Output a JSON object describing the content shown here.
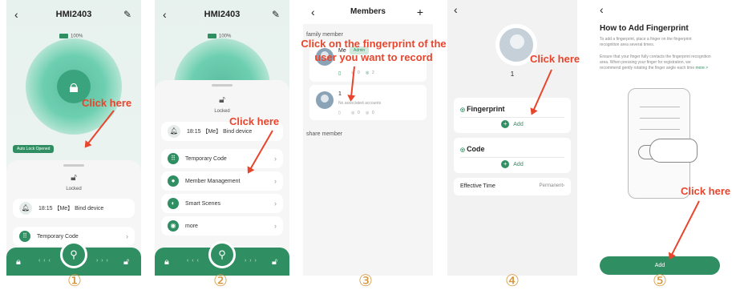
{
  "panel1": {
    "title": "HMI2403",
    "battery": "100%",
    "badge": "Auto Lock Opened",
    "locked": "Locked",
    "log": "18:15 【Me】 Bind device",
    "menu1": "Temporary Code",
    "callout": "Click here",
    "step": "①"
  },
  "panel2": {
    "title": "HMI2403",
    "battery": "100%",
    "locked": "Locked",
    "log": "18:15 【Me】 Bind device",
    "callout": "Click here",
    "menu": [
      "Temporary Code",
      "Member Management",
      "Smart Scenes",
      "more"
    ],
    "step": "②"
  },
  "panel3": {
    "title": "Members",
    "family": "family member",
    "callout": "Click on the fingerprint of the user you want to record",
    "me": "Me",
    "admin": "Admin",
    "m2": "1",
    "m2sub": "No associated accounts",
    "share": "share member",
    "counts1": [
      "0",
      "2"
    ],
    "counts2": [
      "0",
      "0"
    ],
    "step": "③"
  },
  "panel4": {
    "name": "1",
    "callout": "Click here",
    "fingerprint": "Fingerprint",
    "code": "Code",
    "add": "Add",
    "eff": "Effective Time",
    "perm": "Permanent",
    "step": "④"
  },
  "panel5": {
    "title": "How to Add Fingerprint",
    "p1": "To add a fingerprint, place a finger on the fingerprint recognition area several times.",
    "p2": "Ensure that your finger fully contacts the fingerprint recognition area. When pressing your finger for registration, we recommend gently rotating the finger angle each time",
    "more": "more >",
    "callout": "Click here",
    "add": "Add",
    "step": "⑤"
  }
}
